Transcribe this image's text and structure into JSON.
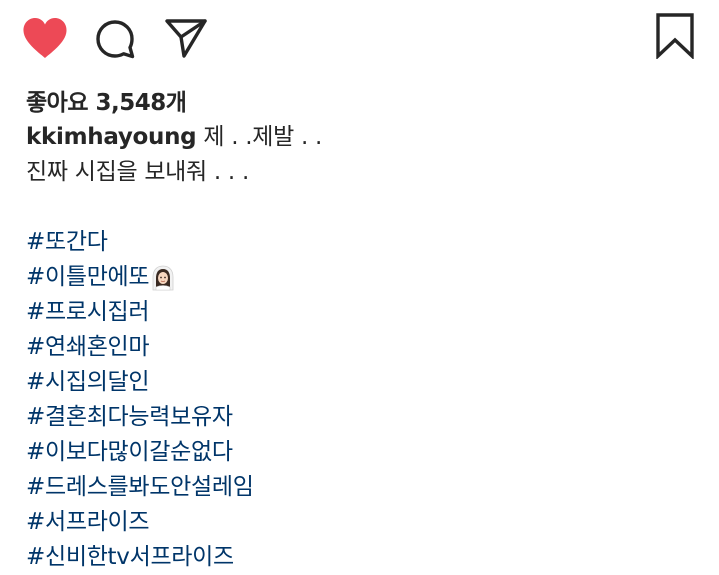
{
  "colors": {
    "like_red": "#ED4956",
    "icon_dark": "#262626",
    "hashtag_blue": "#003569"
  },
  "icons": {
    "like": "heart-filled-icon",
    "comment": "speech-bubble-icon",
    "share": "paper-plane-icon",
    "save": "bookmark-icon",
    "emoji": "bride-with-veil-emoji"
  },
  "likes": {
    "text": "좋아요 3,548개"
  },
  "caption": {
    "username": "kkimhayoung",
    "line1": " 제 . .제발 . .",
    "line2": "진짜 시집을 보내줘 . . .",
    "hashtags": [
      "#또간다",
      "#이틀만에또",
      "#프로시집러",
      "#연쇄혼인마",
      "#시집의달인",
      "#결혼최다능력보유자",
      "#이보다많이갈순없다",
      "#드레스를봐도안설레임",
      "#서프라이즈",
      "#신비한tv서프라이즈"
    ]
  }
}
